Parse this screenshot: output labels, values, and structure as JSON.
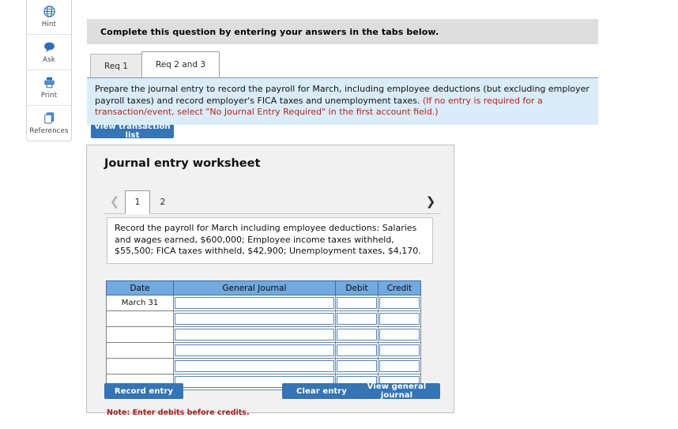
{
  "tool_rail": {
    "items": [
      {
        "label": "Hint",
        "icon": "globe-icon"
      },
      {
        "label": "Ask",
        "icon": "chat-bubble-icon"
      },
      {
        "label": "Print",
        "icon": "printer-icon"
      },
      {
        "label": "References",
        "icon": "copy-pages-icon"
      }
    ]
  },
  "header": {
    "instruction": "Complete this question by entering your answers in the tabs below."
  },
  "tabs": [
    {
      "label": "Req 1",
      "active": false
    },
    {
      "label": "Req 2 and 3",
      "active": true
    }
  ],
  "requirement": {
    "text_black": "Prepare the journal entry to record the payroll for March, including employee deductions (but excluding employer payroll taxes) and record employer's FICA taxes and unemployment taxes. ",
    "text_red": "(If no entry is required for a transaction/event, select \"No Journal Entry Required\" in the first account field.)"
  },
  "buttons": {
    "view_transaction_list": "View transaction list",
    "record_entry": "Record entry",
    "clear_entry": "Clear entry",
    "view_general_journal": "View general journal"
  },
  "worksheet": {
    "title": "Journal entry worksheet",
    "pager": {
      "prev_icon": "chevron-left-icon",
      "next_icon": "chevron-right-icon",
      "pages": [
        {
          "label": "1",
          "active": true
        },
        {
          "label": "2",
          "active": false
        }
      ]
    },
    "transaction_description": "Record the payroll for March including employee deductions: Salaries and wages earned, $600,000; Employee income taxes withheld, $55,500; FICA taxes withheld, $42,900; Unemployment taxes, $4,170.",
    "note": "Note: Enter debits before credits.",
    "table": {
      "headers": [
        "Date",
        "General Journal",
        "Debit",
        "Credit"
      ],
      "rows": [
        {
          "date": "March 31",
          "general_journal": "",
          "debit": "",
          "credit": ""
        },
        {
          "date": "",
          "general_journal": "",
          "debit": "",
          "credit": ""
        },
        {
          "date": "",
          "general_journal": "",
          "debit": "",
          "credit": ""
        },
        {
          "date": "",
          "general_journal": "",
          "debit": "",
          "credit": ""
        },
        {
          "date": "",
          "general_journal": "",
          "debit": "",
          "credit": ""
        },
        {
          "date": "",
          "general_journal": "",
          "debit": "",
          "credit": ""
        }
      ]
    }
  },
  "colors": {
    "accent_blue": "#3574b5",
    "table_header_blue": "#72a9de",
    "panel_blue": "#d9ecf7",
    "alert_red": "#c0201c",
    "note_red": "#a82020",
    "panel_gray": "#f1f1f1",
    "header_gray": "#dedede"
  }
}
